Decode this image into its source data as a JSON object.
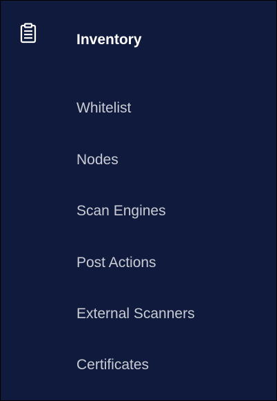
{
  "sidebar": {
    "header": {
      "label": "Inventory",
      "icon": "clipboard-icon"
    },
    "items": [
      {
        "label": "Whitelist"
      },
      {
        "label": "Nodes"
      },
      {
        "label": "Scan Engines"
      },
      {
        "label": "Post Actions"
      },
      {
        "label": "External Scanners"
      },
      {
        "label": "Certificates"
      }
    ]
  },
  "colors": {
    "background": "#0f1a3c",
    "header_text": "#ffffff",
    "item_text": "#c9ccd4",
    "border": "#000000"
  }
}
